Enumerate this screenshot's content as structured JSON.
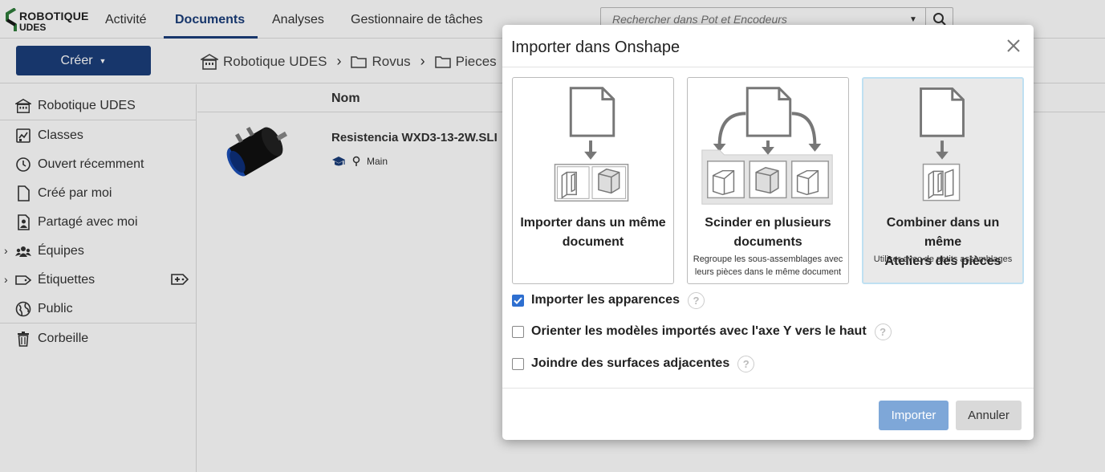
{
  "app": {
    "logo_line1": "ROBOTIQUE",
    "logo_line2": "UDES",
    "nav": [
      "Activité",
      "Documents",
      "Analyses",
      "Gestionnaire de tâches"
    ],
    "search_placeholder": "Rechercher dans Pot et Encodeurs",
    "create_label": "Créer",
    "breadcrumb": [
      "Robotique UDES",
      "Rovus",
      "Pieces"
    ]
  },
  "sidebar": {
    "items": [
      {
        "label": "Robotique UDES",
        "icon": "building-icon"
      },
      {
        "label": "Classes",
        "icon": "classes-icon"
      },
      {
        "label": "Ouvert récemment",
        "icon": "clock-icon"
      },
      {
        "label": "Créé par moi",
        "icon": "document-icon"
      },
      {
        "label": "Partagé avec moi",
        "icon": "shared-user-icon"
      },
      {
        "label": "Équipes",
        "icon": "teams-icon"
      },
      {
        "label": "Étiquettes",
        "icon": "tag-icon"
      },
      {
        "label": "Public",
        "icon": "globe-icon"
      },
      {
        "label": "Corbeille",
        "icon": "trash-icon"
      }
    ]
  },
  "list": {
    "column_name": "Nom",
    "rows": [
      {
        "name": "Resistencia WXD3-13-2W.SLI",
        "branch": "Main"
      }
    ]
  },
  "modal": {
    "title": "Importer dans Onshape",
    "cards": [
      {
        "title_line1": "Importer dans un même",
        "title_line2": "document",
        "subtitle_line1": "",
        "subtitle_line2": "",
        "selected": false
      },
      {
        "title_line1": "Scinder en plusieurs",
        "title_line2": "documents",
        "subtitle_line1": "Regroupe les sous-assemblages avec",
        "subtitle_line2": "leurs pièces dans le même document",
        "selected": false
      },
      {
        "title_line1": "Combiner dans un même",
        "title_line2": "Ateliers des pièces",
        "subtitle_line1": "Utiliser avec de petits assemblages",
        "subtitle_line2": "",
        "selected": true
      }
    ],
    "options": [
      {
        "label": "Importer les apparences",
        "checked": true
      },
      {
        "label": "Orienter les modèles importés avec l'axe Y vers le haut",
        "checked": false
      },
      {
        "label": "Joindre des surfaces adjacentes",
        "checked": false
      }
    ],
    "help_glyph": "?",
    "import_label": "Importer",
    "cancel_label": "Annuler"
  },
  "colors": {
    "brand_navy": "#1b3e7a",
    "checkbox_blue": "#2e6fd0",
    "import_button": "#7ea7d8",
    "selected_card_border": "#bfe0f2"
  }
}
